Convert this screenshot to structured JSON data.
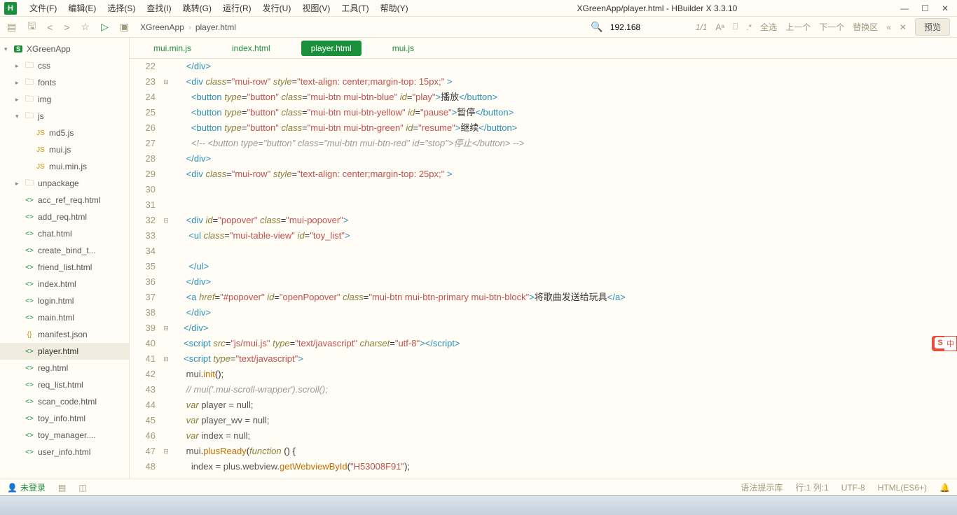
{
  "window": {
    "title": "XGreenApp/player.html - HBuilder X 3.3.10"
  },
  "menu": [
    "文件(F)",
    "编辑(E)",
    "选择(S)",
    "查找(I)",
    "跳转(G)",
    "运行(R)",
    "发行(U)",
    "视图(V)",
    "工具(T)",
    "帮助(Y)"
  ],
  "breadcrumb": {
    "project": "XGreenApp",
    "file": "player.html"
  },
  "search": {
    "value": "192.168",
    "matches": "1/1"
  },
  "rightTools": {
    "selectAll": "全选",
    "prev": "上一个",
    "next": "下一个",
    "replaceArea": "替换区",
    "preview": "预览"
  },
  "tree": [
    {
      "d": 0,
      "icon": "proj",
      "arrow": "v",
      "label": "XGreenApp"
    },
    {
      "d": 1,
      "icon": "folder",
      "arrow": ">",
      "label": "css"
    },
    {
      "d": 1,
      "icon": "folder",
      "arrow": ">",
      "label": "fonts"
    },
    {
      "d": 1,
      "icon": "folder",
      "arrow": ">",
      "label": "img"
    },
    {
      "d": 1,
      "icon": "folder",
      "arrow": "v",
      "label": "js"
    },
    {
      "d": 2,
      "icon": "js",
      "label": "md5.js"
    },
    {
      "d": 2,
      "icon": "js",
      "label": "mui.js"
    },
    {
      "d": 2,
      "icon": "js",
      "label": "mui.min.js"
    },
    {
      "d": 1,
      "icon": "folder",
      "arrow": ">",
      "label": "unpackage"
    },
    {
      "d": 1,
      "icon": "html",
      "label": "acc_ref_req.html"
    },
    {
      "d": 1,
      "icon": "html",
      "label": "add_req.html"
    },
    {
      "d": 1,
      "icon": "html",
      "label": "chat.html"
    },
    {
      "d": 1,
      "icon": "html",
      "label": "create_bind_t..."
    },
    {
      "d": 1,
      "icon": "html",
      "label": "friend_list.html"
    },
    {
      "d": 1,
      "icon": "html",
      "label": "index.html"
    },
    {
      "d": 1,
      "icon": "html",
      "label": "login.html"
    },
    {
      "d": 1,
      "icon": "html",
      "label": "main.html"
    },
    {
      "d": 1,
      "icon": "json",
      "label": "manifest.json"
    },
    {
      "d": 1,
      "icon": "html",
      "label": "player.html",
      "active": true
    },
    {
      "d": 1,
      "icon": "html",
      "label": "reg.html"
    },
    {
      "d": 1,
      "icon": "html",
      "label": "req_list.html"
    },
    {
      "d": 1,
      "icon": "html",
      "label": "scan_code.html"
    },
    {
      "d": 1,
      "icon": "html",
      "label": "toy_info.html"
    },
    {
      "d": 1,
      "icon": "html",
      "label": "toy_manager...."
    },
    {
      "d": 1,
      "icon": "html",
      "label": "user_info.html"
    }
  ],
  "tabs": [
    {
      "label": "mui.min.js"
    },
    {
      "label": "index.html"
    },
    {
      "label": "player.html",
      "active": true
    },
    {
      "label": "mui.js"
    }
  ],
  "code": {
    "startLine": 22,
    "lines": [
      {
        "n": 22,
        "html": "      <span class='tag'>&lt;/div&gt;</span>"
      },
      {
        "n": 23,
        "fold": "⊟",
        "html": "      <span class='tag'>&lt;div</span> <span class='attr'>class</span>=<span class='str'>\"mui-row\"</span> <span class='attr'>style</span>=<span class='str'>\"text-align: center;margin-top: 15px;\"</span> <span class='tag'>&gt;</span>"
      },
      {
        "n": 24,
        "html": "        <span class='tag'>&lt;button</span> <span class='attr'>type</span>=<span class='str'>\"button\"</span> <span class='attr'>class</span>=<span class='str'>\"mui-btn mui-btn-blue\"</span> <span class='attr'>id</span>=<span class='str'>\"play\"</span><span class='tag'>&gt;</span><span class='txt-bl'>播放</span><span class='tag'>&lt;/button&gt;</span>"
      },
      {
        "n": 25,
        "html": "        <span class='tag'>&lt;button</span> <span class='attr'>type</span>=<span class='str'>\"button\"</span> <span class='attr'>class</span>=<span class='str'>\"mui-btn mui-btn-yellow\"</span> <span class='attr'>id</span>=<span class='str'>\"pause\"</span><span class='tag'>&gt;</span><span class='txt-bl'>暂停</span><span class='tag'>&lt;/button&gt;</span>"
      },
      {
        "n": 26,
        "html": "        <span class='tag'>&lt;button</span> <span class='attr'>type</span>=<span class='str'>\"button\"</span> <span class='attr'>class</span>=<span class='str'>\"mui-btn mui-btn-green\"</span> <span class='attr'>id</span>=<span class='str'>\"resume\"</span><span class='tag'>&gt;</span><span class='txt-bl'>继续</span><span class='tag'>&lt;/button&gt;</span>"
      },
      {
        "n": 27,
        "html": "        <span class='comment'>&lt;!-- &lt;button type=\"button\" class=\"mui-btn mui-btn-red\" id=\"stop\"&gt;停止&lt;/button&gt; --&gt;</span>"
      },
      {
        "n": 28,
        "html": "      <span class='tag'>&lt;/div&gt;</span>"
      },
      {
        "n": 29,
        "html": "      <span class='tag'>&lt;div</span> <span class='attr'>class</span>=<span class='str'>\"mui-row\"</span> <span class='attr'>style</span>=<span class='str'>\"text-align: center;margin-top: 25px;\"</span> <span class='tag'>&gt;</span>"
      },
      {
        "n": 30,
        "html": ""
      },
      {
        "n": 31,
        "html": ""
      },
      {
        "n": 32,
        "fold": "⊟",
        "html": "      <span class='tag'>&lt;div</span> <span class='attr'>id</span>=<span class='str'>\"popover\"</span> <span class='attr'>class</span>=<span class='str'>\"mui-popover\"</span><span class='tag'>&gt;</span>"
      },
      {
        "n": 33,
        "html": "       <span class='tag'>&lt;ul</span> <span class='attr'>class</span>=<span class='str'>\"mui-table-view\"</span> <span class='attr'>id</span>=<span class='str'>\"toy_list\"</span><span class='tag'>&gt;</span>"
      },
      {
        "n": 34,
        "html": ""
      },
      {
        "n": 35,
        "html": "       <span class='tag'>&lt;/ul&gt;</span>"
      },
      {
        "n": 36,
        "html": "      <span class='tag'>&lt;/div&gt;</span>"
      },
      {
        "n": 37,
        "html": "      <span class='tag'>&lt;a</span> <span class='attr'>href</span>=<span class='str'>\"#popover\"</span> <span class='attr'>id</span>=<span class='str'>\"openPopover\"</span> <span class='attr'>class</span>=<span class='str'>\"mui-btn mui-btn-primary mui-btn-block\"</span><span class='tag'>&gt;</span><span class='txt-bl'>将歌曲发送给玩具</span><span class='tag'>&lt;/a&gt;</span>"
      },
      {
        "n": 38,
        "html": "      <span class='tag'>&lt;/div&gt;</span>"
      },
      {
        "n": 39,
        "fold": "⊟",
        "html": "     <span class='tag'>&lt;/div&gt;</span>"
      },
      {
        "n": 40,
        "html": "     <span class='tag'>&lt;script</span> <span class='attr'>src</span>=<span class='str'>\"js/mui.js\"</span> <span class='attr'>type</span>=<span class='str'>\"text/javascript\"</span> <span class='attr'>charset</span>=<span class='str'>\"utf-8\"</span><span class='tag'>&gt;&lt;/script&gt;</span>"
      },
      {
        "n": 41,
        "fold": "⊟",
        "html": "     <span class='tag'>&lt;script</span> <span class='attr'>type</span>=<span class='str'>\"text/javascript\"</span><span class='tag'>&gt;</span>"
      },
      {
        "n": 42,
        "html": "      <span class='var'>mui</span>.<span class='fn'>init</span>();"
      },
      {
        "n": 43,
        "html": "      <span class='comment'>// mui('.mui-scroll-wrapper').scroll();</span>"
      },
      {
        "n": 44,
        "html": "      <span class='kw'>var</span> <span class='var'>player = null;</span>"
      },
      {
        "n": 45,
        "html": "      <span class='kw'>var</span> <span class='var'>player_wv = null;</span>"
      },
      {
        "n": 46,
        "html": "      <span class='kw'>var</span> <span class='var'>index = null;</span>"
      },
      {
        "n": 47,
        "fold": "⊟",
        "html": "      <span class='var'>mui</span>.<span class='fn'>plusReady</span>(<span class='kw'>function</span> () {"
      },
      {
        "n": 48,
        "html": "        <span class='var'>index = plus.webview.</span><span class='fn'>getWebviewById</span>(<span class='str'>\"H53008F91\"</span>);"
      }
    ]
  },
  "status": {
    "user": "未登录",
    "syntax": "语法提示库",
    "pos": "行:1 列:1",
    "enc": "UTF-8",
    "lang": "HTML(ES6+)"
  }
}
